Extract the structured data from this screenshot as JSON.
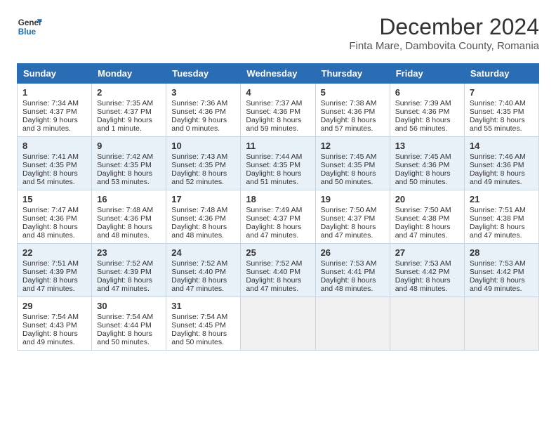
{
  "header": {
    "logo_line1": "General",
    "logo_line2": "Blue",
    "main_title": "December 2024",
    "subtitle": "Finta Mare, Dambovita County, Romania"
  },
  "calendar": {
    "headers": [
      "Sunday",
      "Monday",
      "Tuesday",
      "Wednesday",
      "Thursday",
      "Friday",
      "Saturday"
    ],
    "weeks": [
      [
        {
          "day": "",
          "empty": true
        },
        {
          "day": "",
          "empty": true
        },
        {
          "day": "",
          "empty": true
        },
        {
          "day": "",
          "empty": true
        },
        {
          "day": "",
          "empty": true
        },
        {
          "day": "",
          "empty": true
        },
        {
          "day": "",
          "empty": true
        }
      ],
      [
        {
          "day": "1",
          "sunrise": "Sunrise: 7:34 AM",
          "sunset": "Sunset: 4:37 PM",
          "daylight": "Daylight: 9 hours and 3 minutes."
        },
        {
          "day": "2",
          "sunrise": "Sunrise: 7:35 AM",
          "sunset": "Sunset: 4:37 PM",
          "daylight": "Daylight: 9 hours and 1 minute."
        },
        {
          "day": "3",
          "sunrise": "Sunrise: 7:36 AM",
          "sunset": "Sunset: 4:36 PM",
          "daylight": "Daylight: 9 hours and 0 minutes."
        },
        {
          "day": "4",
          "sunrise": "Sunrise: 7:37 AM",
          "sunset": "Sunset: 4:36 PM",
          "daylight": "Daylight: 8 hours and 59 minutes."
        },
        {
          "day": "5",
          "sunrise": "Sunrise: 7:38 AM",
          "sunset": "Sunset: 4:36 PM",
          "daylight": "Daylight: 8 hours and 57 minutes."
        },
        {
          "day": "6",
          "sunrise": "Sunrise: 7:39 AM",
          "sunset": "Sunset: 4:36 PM",
          "daylight": "Daylight: 8 hours and 56 minutes."
        },
        {
          "day": "7",
          "sunrise": "Sunrise: 7:40 AM",
          "sunset": "Sunset: 4:35 PM",
          "daylight": "Daylight: 8 hours and 55 minutes."
        }
      ],
      [
        {
          "day": "8",
          "sunrise": "Sunrise: 7:41 AM",
          "sunset": "Sunset: 4:35 PM",
          "daylight": "Daylight: 8 hours and 54 minutes."
        },
        {
          "day": "9",
          "sunrise": "Sunrise: 7:42 AM",
          "sunset": "Sunset: 4:35 PM",
          "daylight": "Daylight: 8 hours and 53 minutes."
        },
        {
          "day": "10",
          "sunrise": "Sunrise: 7:43 AM",
          "sunset": "Sunset: 4:35 PM",
          "daylight": "Daylight: 8 hours and 52 minutes."
        },
        {
          "day": "11",
          "sunrise": "Sunrise: 7:44 AM",
          "sunset": "Sunset: 4:35 PM",
          "daylight": "Daylight: 8 hours and 51 minutes."
        },
        {
          "day": "12",
          "sunrise": "Sunrise: 7:45 AM",
          "sunset": "Sunset: 4:35 PM",
          "daylight": "Daylight: 8 hours and 50 minutes."
        },
        {
          "day": "13",
          "sunrise": "Sunrise: 7:45 AM",
          "sunset": "Sunset: 4:36 PM",
          "daylight": "Daylight: 8 hours and 50 minutes."
        },
        {
          "day": "14",
          "sunrise": "Sunrise: 7:46 AM",
          "sunset": "Sunset: 4:36 PM",
          "daylight": "Daylight: 8 hours and 49 minutes."
        }
      ],
      [
        {
          "day": "15",
          "sunrise": "Sunrise: 7:47 AM",
          "sunset": "Sunset: 4:36 PM",
          "daylight": "Daylight: 8 hours and 48 minutes."
        },
        {
          "day": "16",
          "sunrise": "Sunrise: 7:48 AM",
          "sunset": "Sunset: 4:36 PM",
          "daylight": "Daylight: 8 hours and 48 minutes."
        },
        {
          "day": "17",
          "sunrise": "Sunrise: 7:48 AM",
          "sunset": "Sunset: 4:36 PM",
          "daylight": "Daylight: 8 hours and 48 minutes."
        },
        {
          "day": "18",
          "sunrise": "Sunrise: 7:49 AM",
          "sunset": "Sunset: 4:37 PM",
          "daylight": "Daylight: 8 hours and 47 minutes."
        },
        {
          "day": "19",
          "sunrise": "Sunrise: 7:50 AM",
          "sunset": "Sunset: 4:37 PM",
          "daylight": "Daylight: 8 hours and 47 minutes."
        },
        {
          "day": "20",
          "sunrise": "Sunrise: 7:50 AM",
          "sunset": "Sunset: 4:38 PM",
          "daylight": "Daylight: 8 hours and 47 minutes."
        },
        {
          "day": "21",
          "sunrise": "Sunrise: 7:51 AM",
          "sunset": "Sunset: 4:38 PM",
          "daylight": "Daylight: 8 hours and 47 minutes."
        }
      ],
      [
        {
          "day": "22",
          "sunrise": "Sunrise: 7:51 AM",
          "sunset": "Sunset: 4:39 PM",
          "daylight": "Daylight: 8 hours and 47 minutes."
        },
        {
          "day": "23",
          "sunrise": "Sunrise: 7:52 AM",
          "sunset": "Sunset: 4:39 PM",
          "daylight": "Daylight: 8 hours and 47 minutes."
        },
        {
          "day": "24",
          "sunrise": "Sunrise: 7:52 AM",
          "sunset": "Sunset: 4:40 PM",
          "daylight": "Daylight: 8 hours and 47 minutes."
        },
        {
          "day": "25",
          "sunrise": "Sunrise: 7:52 AM",
          "sunset": "Sunset: 4:40 PM",
          "daylight": "Daylight: 8 hours and 47 minutes."
        },
        {
          "day": "26",
          "sunrise": "Sunrise: 7:53 AM",
          "sunset": "Sunset: 4:41 PM",
          "daylight": "Daylight: 8 hours and 48 minutes."
        },
        {
          "day": "27",
          "sunrise": "Sunrise: 7:53 AM",
          "sunset": "Sunset: 4:42 PM",
          "daylight": "Daylight: 8 hours and 48 minutes."
        },
        {
          "day": "28",
          "sunrise": "Sunrise: 7:53 AM",
          "sunset": "Sunset: 4:42 PM",
          "daylight": "Daylight: 8 hours and 49 minutes."
        }
      ],
      [
        {
          "day": "29",
          "sunrise": "Sunrise: 7:54 AM",
          "sunset": "Sunset: 4:43 PM",
          "daylight": "Daylight: 8 hours and 49 minutes."
        },
        {
          "day": "30",
          "sunrise": "Sunrise: 7:54 AM",
          "sunset": "Sunset: 4:44 PM",
          "daylight": "Daylight: 8 hours and 50 minutes."
        },
        {
          "day": "31",
          "sunrise": "Sunrise: 7:54 AM",
          "sunset": "Sunset: 4:45 PM",
          "daylight": "Daylight: 8 hours and 50 minutes."
        },
        {
          "day": "",
          "empty": true
        },
        {
          "day": "",
          "empty": true
        },
        {
          "day": "",
          "empty": true
        },
        {
          "day": "",
          "empty": true
        }
      ]
    ]
  }
}
